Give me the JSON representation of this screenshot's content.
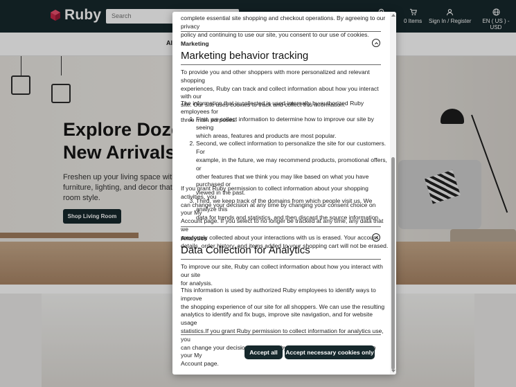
{
  "header": {
    "brand": "Ruby",
    "search_placeholder": "Search",
    "cart_label": "0 Items",
    "account_label": "Sign In / Register",
    "locale_label": "EN ( US ) - USD",
    "brand_color": "#16282c"
  },
  "nav": {
    "first_item": "Al"
  },
  "hero": {
    "title_line1": "Explore Dozen",
    "title_line2": "New Arrivals",
    "subtitle_line1": "Freshen up your living space with",
    "subtitle_line2": "furniture, lighting, and decor that",
    "subtitle_line3": "room style.",
    "button": "Shop Living Room"
  },
  "modal": {
    "essential_tail_line1": "complete essential site shopping and checkout operations. By agreeing to our privacy",
    "essential_tail_line2": "policy and continuing to use our site, you consent to our use of cookies.",
    "marketing": {
      "label": "Marketing",
      "title": "Marketing behavior tracking",
      "intro_lines": [
        "To provide you and other shoppers with more personalized and relevant shopping",
        "experiences, Ruby can track and collect information about how you interact with our",
        "site. Our site uses cookies to track and collect this information."
      ],
      "purposes_lines": [
        "The information that is collected is used internally by authorized Ruby employees for",
        "three main purposes:"
      ],
      "items": [
        [
          "First, we collect information to determine how to improve our site by seeing",
          "which areas, features and products are most popular."
        ],
        [
          "Second, we collect information to personalize the site for our customers. For",
          "example, in the future, we may recommend products, promotional offers, or",
          "other features that we think you may like based on what you have purchased or",
          "viewed in the past."
        ],
        [
          "Third, we keep track of the domains from which people visit us. We analyze this",
          "data for trends and statistics, and then discard the source information."
        ]
      ],
      "consent_lines": [
        "If you grant Ruby permission to collect information about your shopping activities, you",
        "can change your decision at any time by changing your consent choice on your My",
        "Account page. If you select to no longer be tracked at any time, any data that we",
        "previously collected about your interactions with us is erased. Your account",
        "details, order history, and items added to your shopping cart will not be erased."
      ]
    },
    "analytics": {
      "label": "Analytics",
      "title": "Data Collection for Analytics",
      "intro_lines": [
        "To improve our site, Ruby can collect information about how you interact with our site",
        "for analysis."
      ],
      "detail_lines": [
        "This information is used by authorized Ruby employees to identify ways to improve",
        "the shopping experience of our site for all shoppers. We can use the resulting",
        "analytics to identify and fix bugs, improve site navigation, and for website usage",
        "statistics.If you grant Ruby permission to collect information for analytics use, you",
        "can change your decision at any time by changing your consent choice on your My",
        "Account page."
      ]
    },
    "accept_all": "Accept all",
    "accept_necessary": "Accept necessary cookies only"
  }
}
